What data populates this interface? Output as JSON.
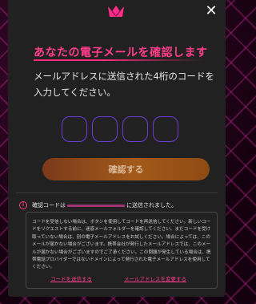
{
  "header": {
    "logo_icon": "crown-logo",
    "close_icon": "close-icon",
    "close_symbol": "✕"
  },
  "title": "あなたの電子メールを確認します",
  "instruction": "メールアドレスに送信された4桁のコードを入力してください。",
  "code_inputs": [
    "",
    "",
    "",
    ""
  ],
  "confirm_button": "確認する",
  "notice": {
    "icon_symbol": "i",
    "prefix": "確認コードは",
    "suffix": "に送信されました。"
  },
  "help": {
    "text": "コードを受信しない場合は、ボタンを使用してコードを再送信してください。新しいコードをリクエストする前に、迷惑メールフォルダーを確認してください。まだコードを受け取っていない場合は、別の電子メールアドレスをお試しください。場合によっては、このメールが届かない場合がございます。携帯会社が発行したメールアドレスでは、このメールが届かない場合がございますのでご了承ください。この問題が発生している場合は、携帯電話プロバイダーではないドメインによって発行された電子メールアドレスを使用してください。",
    "resend_link": "コードを送信する",
    "change_email_link": "メールアドレスを変更する"
  },
  "colors": {
    "accent": "#ff3d8b",
    "button": "#a35a1a",
    "code_border": "#6b3dd6",
    "modal_bg": "#212121"
  }
}
